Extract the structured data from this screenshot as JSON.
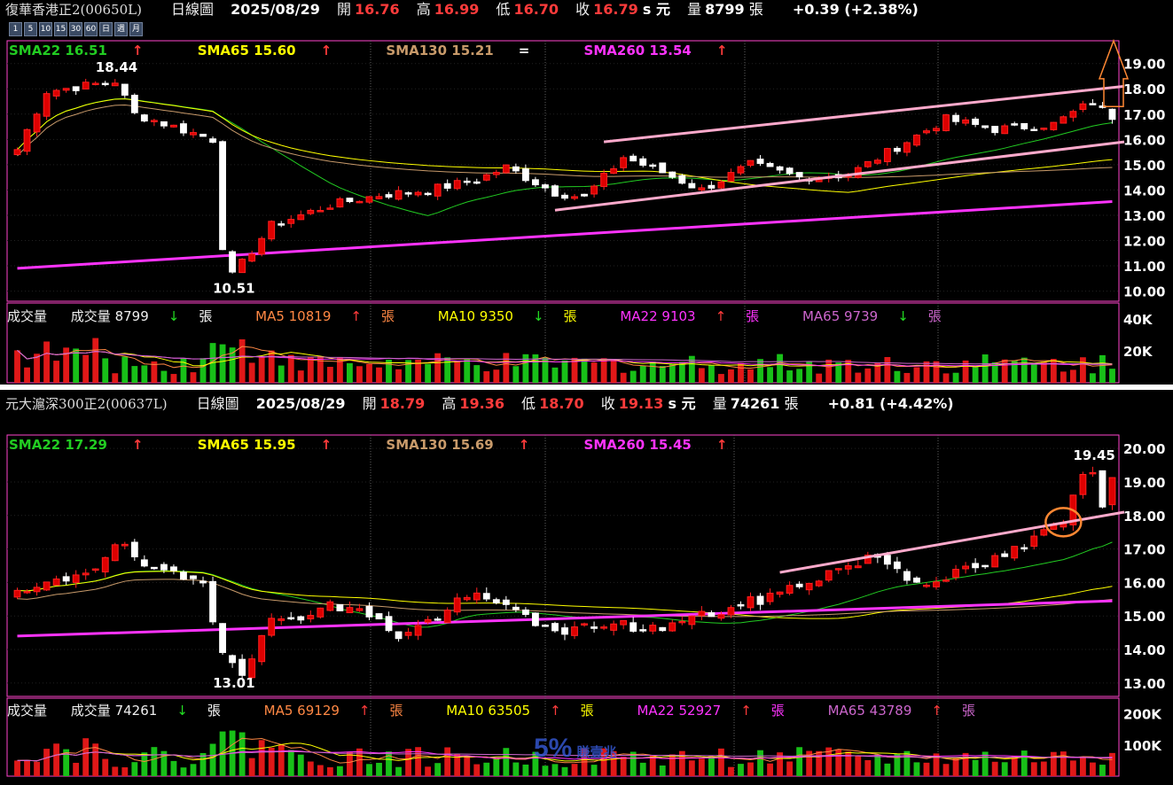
{
  "colors": {
    "up": "#ff2020",
    "down": "#ffffff",
    "sma22": "#22cc22",
    "sma65": "#ffff00",
    "sma130": "#c89a6a",
    "sma260": "#ff33ff",
    "trend": "#ffaacc",
    "ma5": "#ff8844",
    "ma10": "#ffff00",
    "ma22": "#ff33ff",
    "ma65": "#cc66cc",
    "grid": "#606060",
    "frame": "#ff44cc"
  },
  "timeframes": [
    "1",
    "5",
    "10",
    "15",
    "30",
    "60",
    "日",
    "週",
    "月"
  ],
  "panels": [
    {
      "name": "復華香港正2(00650L)",
      "period": "日線圖",
      "date": "2025/08/29",
      "open_label": "開",
      "open": "16.76",
      "high_label": "高",
      "high": "16.99",
      "low_label": "低",
      "low": "16.70",
      "close_label": "收",
      "close": "16.79",
      "close_suffix": "s 元",
      "vol_label": "量",
      "volume": "8799",
      "vol_unit": "張",
      "change": "+0.39 (+2.38%)",
      "sma": [
        {
          "label": "SMA22 16.51",
          "arrow": "↑"
        },
        {
          "label": "SMA65 15.60",
          "arrow": "↑"
        },
        {
          "label": "SMA130 15.21",
          "arrow": "="
        },
        {
          "label": "SMA260 13.54",
          "arrow": "↑"
        }
      ],
      "vol_legend": {
        "title": "成交量",
        "items": [
          {
            "label": "成交量 8799",
            "arrow": "↓",
            "unit": "張"
          },
          {
            "label": "MA5 10819",
            "arrow": "↑",
            "unit": "張"
          },
          {
            "label": "MA10 9350",
            "arrow": "↓",
            "unit": "張"
          },
          {
            "label": "MA22 9103",
            "arrow": "↑",
            "unit": "張"
          },
          {
            "label": "MA65 9739",
            "arrow": "↓",
            "unit": "張"
          }
        ]
      },
      "high_mark": "18.44",
      "low_mark": "10.51"
    },
    {
      "name": "元大滬深300正2(00637L)",
      "period": "日線圖",
      "date": "2025/08/29",
      "open_label": "開",
      "open": "18.79",
      "high_label": "高",
      "high": "19.36",
      "low_label": "低",
      "low": "18.70",
      "close_label": "收",
      "close": "19.13",
      "close_suffix": "s 元",
      "vol_label": "量",
      "volume": "74261",
      "vol_unit": "張",
      "change": "+0.81 (+4.42%)",
      "sma": [
        {
          "label": "SMA22 17.29",
          "arrow": "↑"
        },
        {
          "label": "SMA65 15.95",
          "arrow": "↑"
        },
        {
          "label": "SMA130 15.69",
          "arrow": "↑"
        },
        {
          "label": "SMA260 15.45",
          "arrow": "↑"
        }
      ],
      "vol_legend": {
        "title": "成交量",
        "items": [
          {
            "label": "成交量 74261",
            "arrow": "↓",
            "unit": "張"
          },
          {
            "label": "MA5 69129",
            "arrow": "↑",
            "unit": "張"
          },
          {
            "label": "MA10 63505",
            "arrow": "↑",
            "unit": "張"
          },
          {
            "label": "MA22 52927",
            "arrow": "↑",
            "unit": "張"
          },
          {
            "label": "MA65 43789",
            "arrow": "↑",
            "unit": "張"
          }
        ]
      },
      "high_mark": "19.45",
      "low_mark": "13.01"
    }
  ],
  "watermark": {
    "big": "5%",
    "small": "賺壹兆"
  },
  "chart_data": [
    {
      "type": "candlestick",
      "title": "復華香港正2(00650L) 日線圖",
      "ylim": [
        9.6,
        19.9
      ],
      "yticks": [
        "10.00",
        "11.00",
        "12.00",
        "13.00",
        "14.00",
        "15.00",
        "16.00",
        "17.00",
        "18.00",
        "19.00"
      ],
      "n": 113,
      "key_points": [
        [
          0,
          15.6
        ],
        [
          3,
          17.9
        ],
        [
          10,
          18.3
        ],
        [
          12,
          17.0
        ],
        [
          20,
          16.0
        ],
        [
          21,
          11.8
        ],
        [
          22,
          10.6
        ],
        [
          26,
          12.6
        ],
        [
          32,
          13.4
        ],
        [
          37,
          13.8
        ],
        [
          42,
          14.0
        ],
        [
          47,
          14.4
        ],
        [
          50,
          14.9
        ],
        [
          55,
          13.9
        ],
        [
          58,
          13.7
        ],
        [
          62,
          15.3
        ],
        [
          66,
          14.7
        ],
        [
          70,
          14.0
        ],
        [
          75,
          15.0
        ],
        [
          80,
          14.5
        ],
        [
          85,
          14.6
        ],
        [
          90,
          15.7
        ],
        [
          95,
          16.8
        ],
        [
          100,
          16.4
        ],
        [
          106,
          16.6
        ],
        [
          110,
          17.5
        ],
        [
          112,
          16.79
        ]
      ],
      "sma22_range": [
        14.6,
        16.51
      ],
      "sma260_range": [
        10.9,
        13.54
      ],
      "volume_axis": [
        "40K",
        "20K"
      ],
      "last_volume": 8799
    },
    {
      "type": "candlestick",
      "title": "元大滬深300正2(00637L) 日線圖",
      "ylim": [
        12.6,
        20.4
      ],
      "yticks": [
        "13.00",
        "14.00",
        "15.00",
        "16.00",
        "17.00",
        "18.00",
        "19.00",
        "20.00"
      ],
      "n": 113,
      "key_points": [
        [
          0,
          15.6
        ],
        [
          4,
          16.0
        ],
        [
          8,
          16.5
        ],
        [
          10,
          17.2
        ],
        [
          14,
          16.3
        ],
        [
          19,
          16.0
        ],
        [
          21,
          14.0
        ],
        [
          23,
          13.4
        ],
        [
          26,
          14.8
        ],
        [
          32,
          15.3
        ],
        [
          37,
          15.0
        ],
        [
          39,
          14.3
        ],
        [
          44,
          15.2
        ],
        [
          46,
          15.6
        ],
        [
          52,
          15.1
        ],
        [
          55,
          14.4
        ],
        [
          60,
          14.8
        ],
        [
          65,
          14.6
        ],
        [
          70,
          15.0
        ],
        [
          74,
          15.3
        ],
        [
          78,
          15.7
        ],
        [
          83,
          16.3
        ],
        [
          88,
          16.8
        ],
        [
          92,
          16.0
        ],
        [
          98,
          16.4
        ],
        [
          103,
          17.1
        ],
        [
          107,
          17.8
        ],
        [
          109,
          19.2
        ],
        [
          110,
          19.3
        ],
        [
          111,
          18.4
        ],
        [
          112,
          19.13
        ]
      ],
      "sma22_range": [
        15.8,
        17.29
      ],
      "sma260_range": [
        14.4,
        15.45
      ],
      "volume_axis": [
        "200K",
        "100K"
      ],
      "last_volume": 74261
    }
  ]
}
